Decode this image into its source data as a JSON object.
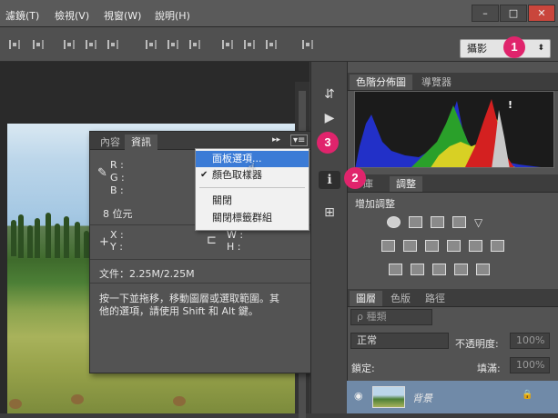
{
  "menubar": {
    "items": [
      "濾鏡(T)",
      "檢視(V)",
      "視窗(W)",
      "說明(H)"
    ],
    "window_buttons": [
      "–",
      "□",
      "✕"
    ]
  },
  "options_bar": {
    "workspace": "攝影"
  },
  "badges": [
    "1",
    "2",
    "3"
  ],
  "info_panel": {
    "tabs": [
      "內容",
      "資訊"
    ],
    "rgb_labels": [
      "R :",
      "G :",
      "B :"
    ],
    "bit_depth": "8 位元",
    "xy_labels": [
      "X :",
      "Y :"
    ],
    "wh_labels": [
      "W :",
      "H :"
    ],
    "file_info": "文件：2.25M/2.25M",
    "hint_line1": "按一下並拖移，移動圖層或選取範圍。其",
    "hint_line2": "他的選項，請使用 Shift 和 Alt 鍵。",
    "menu_button": "▾≡",
    "collapse": "▸▸"
  },
  "panel_menu": {
    "items": [
      "面板選項...",
      "顏色取樣器",
      "關閉",
      "關閉標籤群組"
    ],
    "checked": "✔"
  },
  "dock": {
    "histogram_tabs": [
      "色階分佈圖",
      "導覽器"
    ],
    "warning": "!",
    "adjust_tabs": [
      "庫",
      "調整"
    ],
    "adjust_title": "增加調整",
    "layers_tabs": [
      "圖層",
      "色版",
      "路徑"
    ],
    "filter_kind": "ρ 種類",
    "blend_mode": "正常",
    "opacity_label": "不透明度:",
    "opacity_value": "100%",
    "lock_label": "鎖定:",
    "fill_label": "填滿:",
    "fill_value": "100%",
    "layer_name": "背景",
    "eye": "◉",
    "lock": "🔒"
  },
  "colors": {
    "badge": "#e0246c",
    "highlight": "#3b7bd6"
  }
}
